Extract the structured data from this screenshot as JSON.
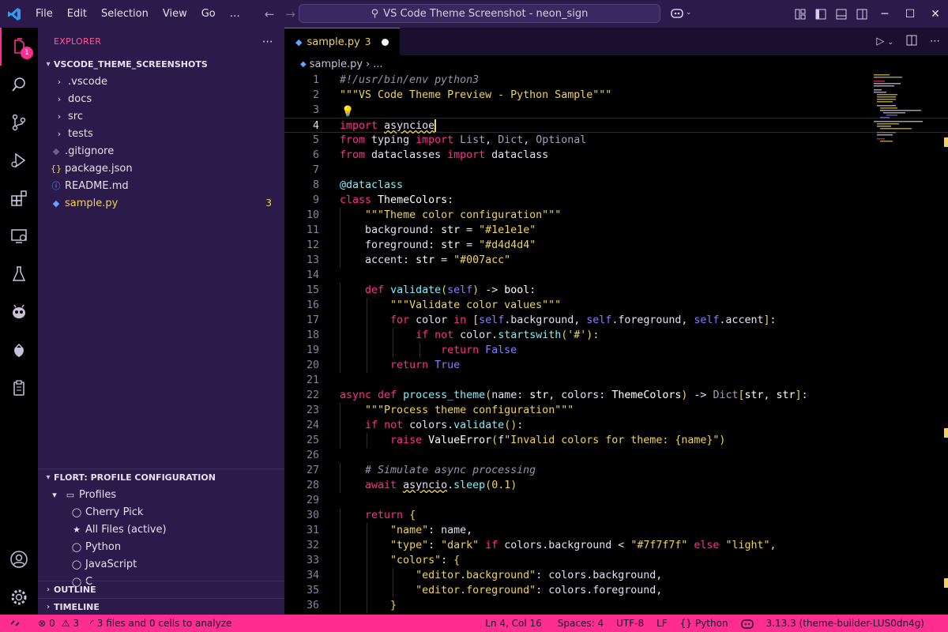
{
  "titlebar": {
    "menu": [
      "File",
      "Edit",
      "Selection",
      "View",
      "Go",
      "…"
    ],
    "search_text": "VS Code Theme Screenshot - neon_sign"
  },
  "activity": {
    "explorer_badge": "1"
  },
  "sidebar": {
    "title": "EXPLORER",
    "folder": "VSCODE_THEME_SCREENSHOTS",
    "items": [
      {
        "label": ".vscode",
        "type": "folder"
      },
      {
        "label": "docs",
        "type": "folder"
      },
      {
        "label": "src",
        "type": "folder"
      },
      {
        "label": "tests",
        "type": "folder"
      },
      {
        "label": ".gitignore",
        "type": "file"
      },
      {
        "label": "package.json",
        "type": "file"
      },
      {
        "label": "README.md",
        "type": "file"
      },
      {
        "label": "sample.py",
        "type": "file",
        "count": "3"
      }
    ],
    "profile_section": "FLORT: PROFILE CONFIGURATION",
    "profiles_label": "Profiles",
    "profiles": [
      "Cherry Pick",
      "All Files (active)",
      "Python",
      "JavaScript",
      "C"
    ],
    "outline": "OUTLINE",
    "timeline": "TIMELINE"
  },
  "editor": {
    "tab_label": "sample.py",
    "tab_problems": "3",
    "breadcrumb_file": "sample.py",
    "breadcrumb_more": "...",
    "current_line": 4,
    "lines": [
      "#!/usr/bin/env python3",
      "\"\"\"VS Code Theme Preview - Python Sample\"\"\"",
      "",
      "import asyncioe",
      "from typing import List, Dict, Optional",
      "from dataclasses import dataclass",
      "",
      "@dataclass",
      "class ThemeColors:",
      "    \"\"\"Theme color configuration\"\"\"",
      "    background: str = \"#1e1e1e\"",
      "    foreground: str = \"#d4d4d4\"",
      "    accent: str = \"#007acc\"",
      "",
      "    def validate(self) -> bool:",
      "        \"\"\"Validate color values\"\"\"",
      "        for color in [self.background, self.foreground, self.accent]:",
      "            if not color.startswith('#'):",
      "                return False",
      "        return True",
      "",
      "async def process_theme(name: str, colors: ThemeColors) -> Dict[str, str]:",
      "    \"\"\"Process theme configuration\"\"\"",
      "    if not colors.validate():",
      "        raise ValueError(f\"Invalid colors for theme: {name}\")",
      "",
      "    # Simulate async processing",
      "    await asyncio.sleep(0.1)",
      "",
      "    return {",
      "        \"name\": name,",
      "        \"type\": \"dark\" if colors.background < \"#7f7f7f\" else \"light\",",
      "        \"colors\": {",
      "            \"editor.background\": colors.background,",
      "            \"editor.foreground\": colors.foreground,",
      "        }"
    ]
  },
  "status": {
    "errors": "0",
    "warnings": "3",
    "analyze": "3 files and 0 cells to analyze",
    "position": "Ln 4, Col 16",
    "spaces": "Spaces: 4",
    "encoding": "UTF-8",
    "eol": "LF",
    "language": "Python",
    "interpreter": "3.13.3 (theme-builder-LUS0dn4g)"
  },
  "colors": {
    "accent": "#ff2d8f",
    "sidebar_bg": "#2b1a4a",
    "string": "#f0d35a",
    "keyword": "#ff2d8f",
    "function": "#7cf0ff"
  }
}
